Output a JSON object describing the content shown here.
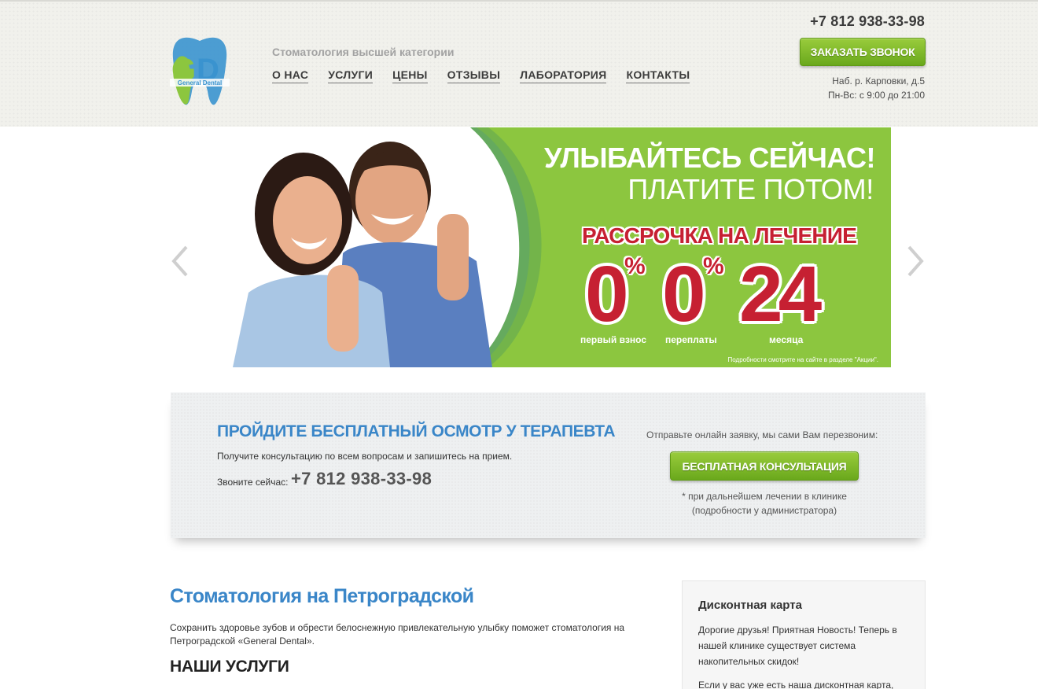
{
  "header": {
    "logo_text": "General Dental",
    "tagline": "Стоматология высшей категории",
    "nav": [
      "О НАС",
      "УСЛУГИ",
      "ЦЕНЫ",
      "ОТЗЫВЫ",
      "ЛАБОРАТОРИЯ",
      "КОНТАКТЫ"
    ],
    "phone": "+7 812 938-33-98",
    "call_button": "ЗАКАЗАТЬ ЗВОНОК",
    "address": "Наб. р. Карповки, д.5",
    "hours": "Пн-Вс: с 9:00 до 21:00"
  },
  "slider": {
    "line1": "УЛЫБАЙТЕСЬ СЕЙЧАС!",
    "line2": "ПЛАТИТЕ ПОТОМ!",
    "line3": "РАССРОЧКА НА ЛЕЧЕНИЕ",
    "num1": "0",
    "num2": "0",
    "num3": "24",
    "percent": "%",
    "cap1": "первый взнос",
    "cap2": "переплаты",
    "cap3": "месяца",
    "note": "Подробности смотрите на сайте в разделе \"Акции\"."
  },
  "promo": {
    "title": "ПРОЙДИТЕ БЕСПЛАТНЫЙ ОСМОТР У ТЕРАПЕВТА",
    "description": "Получите консультацию по всем вопросам и запишитесь на прием.",
    "phone_label": "Звоните сейчас:",
    "phone": "+7 812 938-33-98",
    "right_label": "Отправьте онлайн заявку, мы сами Вам перезвоним:",
    "button": "БЕСПЛАТНАЯ КОНСУЛЬТАЦИЯ",
    "footnote_line1": "* при дальнейшем лечении в клинике",
    "footnote_line2": "(подробности у администратора)"
  },
  "content": {
    "title": "Стоматология на Петроградской",
    "text": "Сохранить здоровье зубов и обрести белоснежную привлекательную улыбку поможет стоматология на Петроградской «General Dental».",
    "services_title": "НАШИ УСЛУГИ"
  },
  "sidebar": {
    "title": "Дисконтная карта",
    "text": "Дорогие друзья! Приятная Новость! Теперь в нашей клинике существует система накопительных скидок!",
    "text2": "Если у вас уже есть наша дисконтная карта,"
  },
  "colors": {
    "accent_blue": "#3a86c8",
    "button_green": "#7cb82a",
    "slide_green": "#8cc63f",
    "promo_red": "#c62032"
  }
}
